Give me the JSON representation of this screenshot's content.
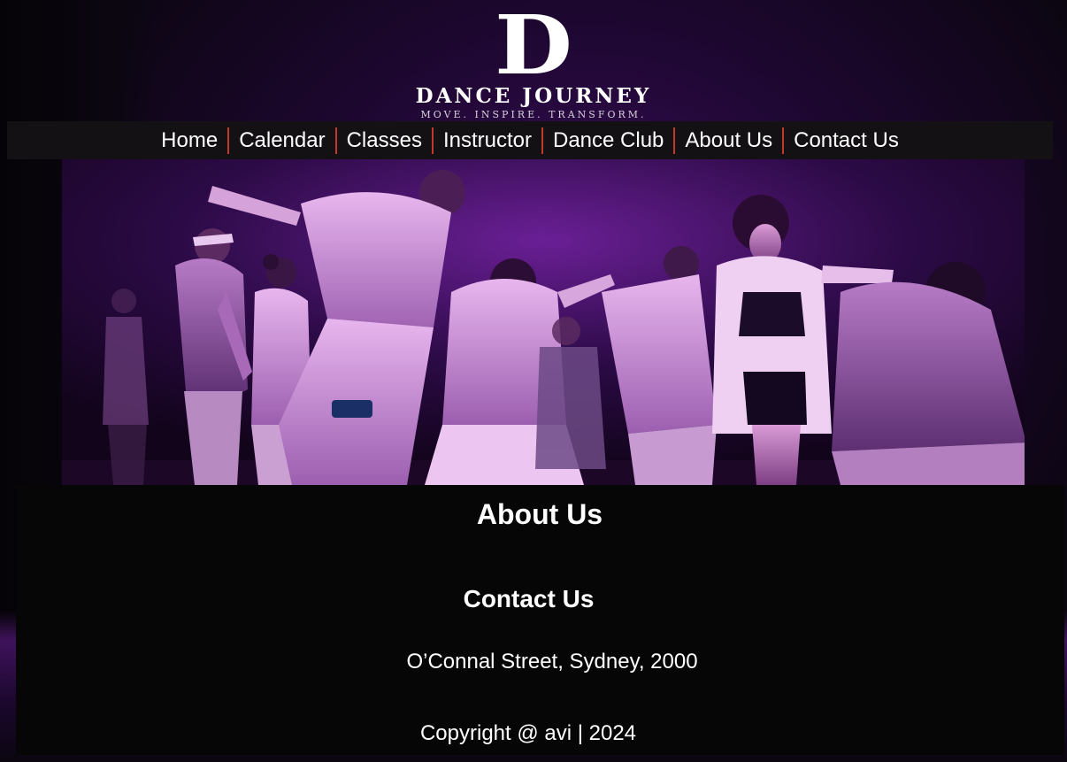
{
  "logo": {
    "mark": "D",
    "name": "DANCE JOURNEY",
    "tagline": "MOVE. INSPIRE. TRANSFORM."
  },
  "nav": {
    "items": [
      {
        "label": "Home"
      },
      {
        "label": "Calendar"
      },
      {
        "label": "Classes"
      },
      {
        "label": "Instructor"
      },
      {
        "label": "Dance Club"
      },
      {
        "label": "About Us"
      },
      {
        "label": "Contact Us"
      }
    ]
  },
  "hero": {
    "image": "dance-performance-photo"
  },
  "about": {
    "title": "About Us"
  },
  "contact": {
    "title": "Contact Us",
    "address": "O’Connal Street, Sydney, 2000"
  },
  "footer": {
    "copyright": "Copyright @ avi | 2024"
  },
  "colors": {
    "background": "#0b0610",
    "nav_background": "#131113",
    "nav_separator": "#c0392b",
    "panel_background": "#060606",
    "text": "#ffffff"
  }
}
